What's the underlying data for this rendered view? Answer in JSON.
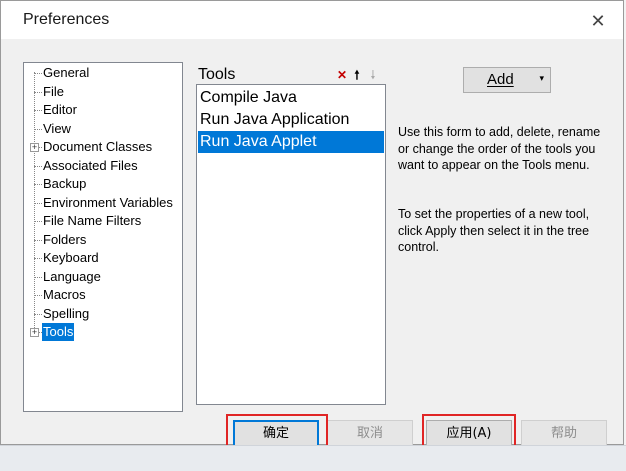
{
  "window": {
    "title": "Preferences"
  },
  "tree": {
    "items": [
      {
        "label": "General"
      },
      {
        "label": "File"
      },
      {
        "label": "Editor"
      },
      {
        "label": "View"
      },
      {
        "label": "Document Classes",
        "expandable": true
      },
      {
        "label": "Associated Files"
      },
      {
        "label": "Backup"
      },
      {
        "label": "Environment Variables"
      },
      {
        "label": "File Name Filters"
      },
      {
        "label": "Folders"
      },
      {
        "label": "Keyboard"
      },
      {
        "label": "Language"
      },
      {
        "label": "Macros"
      },
      {
        "label": "Spelling"
      },
      {
        "label": "Tools",
        "expandable": true,
        "selected": true
      }
    ]
  },
  "tools": {
    "header": "Tools",
    "icons": {
      "delete": "✕",
      "move_up": "🠕",
      "move_down": "🠗"
    },
    "items": [
      {
        "label": "Compile Java"
      },
      {
        "label": "Run Java Application"
      },
      {
        "label": "Run Java Applet",
        "selected": true
      }
    ]
  },
  "add_button": {
    "label": "Add",
    "caret": "▾"
  },
  "help": {
    "paragraph1": "Use this form to add, delete, rename or change the order of the tools you want to appear on the Tools menu.",
    "paragraph2": "To set the properties of a new tool, click Apply then select it in the tree control."
  },
  "buttons": {
    "ok": "确定",
    "cancel": "取消",
    "apply": "应用(A)",
    "help": "帮助"
  },
  "colors": {
    "selection": "#0078d7",
    "highlight_box": "#e02525"
  }
}
